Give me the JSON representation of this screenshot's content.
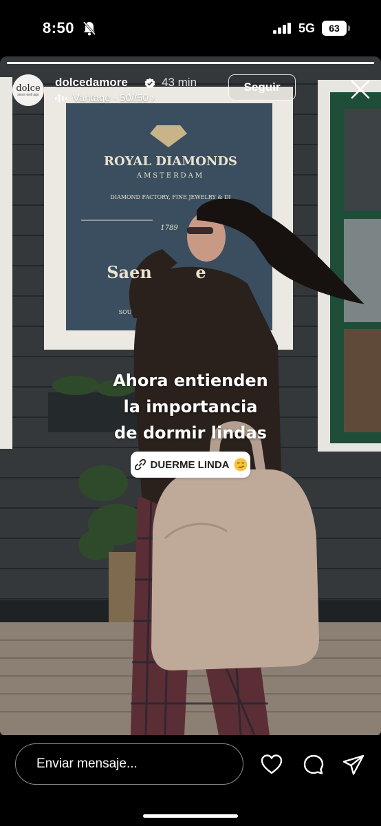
{
  "status_bar": {
    "time": "8:50",
    "network": "5G",
    "battery": "63",
    "icons": [
      "bell-slash-icon",
      "signal-icon"
    ]
  },
  "story": {
    "username": "dolcedamore",
    "timestamp": "43 min",
    "music": "Vantage · 50//50",
    "music_chevron": "›",
    "follow_label": "Seguir",
    "avatar_text": "dolce",
    "avatar_subtext": "since well ago",
    "progress": 1.0,
    "caption_lines": [
      "Ahora entienden",
      "la importancia",
      "de dormir lindas"
    ],
    "link_label": "DUERME LINDA",
    "photo": {
      "sign_title": "ROYAL DIAMONDS",
      "sign_city": "AMSTERDAM",
      "sign_tagline": "DIAMOND FACTORY, FINE JEWELRY & DI",
      "sign_year": "1789",
      "sign_bottom": "Saen",
      "sign_bottom_right": "e",
      "sign_footer": "SOU"
    },
    "colors": {
      "accent": "#ffffff",
      "verified": "#ffffff"
    }
  },
  "bottom_bar": {
    "message_placeholder": "Enviar mensaje...",
    "actions": [
      "heart-icon",
      "comment-icon",
      "send-icon"
    ]
  }
}
